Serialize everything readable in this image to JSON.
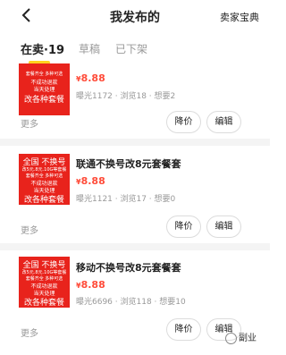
{
  "header": {
    "title": "我发布的",
    "right_link": "卖家宝典"
  },
  "tabs": [
    {
      "label": "在卖·19"
    },
    {
      "label": "草稿"
    },
    {
      "label": "已下架"
    }
  ],
  "items": [
    {
      "thumb": {
        "line1": "",
        "line2": "",
        "line3": "套餐齐全 多种可选",
        "line4": "不成功退款",
        "line5": "当天处理",
        "line6": "改各种套餐"
      },
      "title": "",
      "price_symbol": "¥",
      "price": "8.88",
      "stats": "曝光1172 · 浏览18 · 想要2",
      "more": "更多",
      "btn_price": "降价",
      "btn_edit": "编辑"
    },
    {
      "thumb": {
        "line1": "全国   不换号",
        "line2": "改5元.8元.10G等套餐",
        "line3": "套餐齐全 多种可选",
        "line4": "不成功退款",
        "line5": "当天处理",
        "line6": "改各种套餐"
      },
      "title": "联通不换号改8元套餐套",
      "price_symbol": "¥",
      "price": "8.88",
      "stats": "曝光1121 · 浏览17 · 想要0",
      "more": "更多",
      "btn_price": "降价",
      "btn_edit": "编辑"
    },
    {
      "thumb": {
        "line1": "全国   不换号",
        "line2": "改5元.8元.10G等套餐",
        "line3": "套餐齐全 多种可选",
        "line4": "不成功退款",
        "line5": "当天处理",
        "line6": "改各种套餐"
      },
      "title": "移动不换号改8元套餐套",
      "price_symbol": "¥",
      "price": "8.88",
      "stats": "曝光6696 · 浏览118 · 想要10",
      "more": "更多",
      "btn_price": "降价",
      "btn_edit": "编辑"
    }
  ],
  "watermark": "副业"
}
